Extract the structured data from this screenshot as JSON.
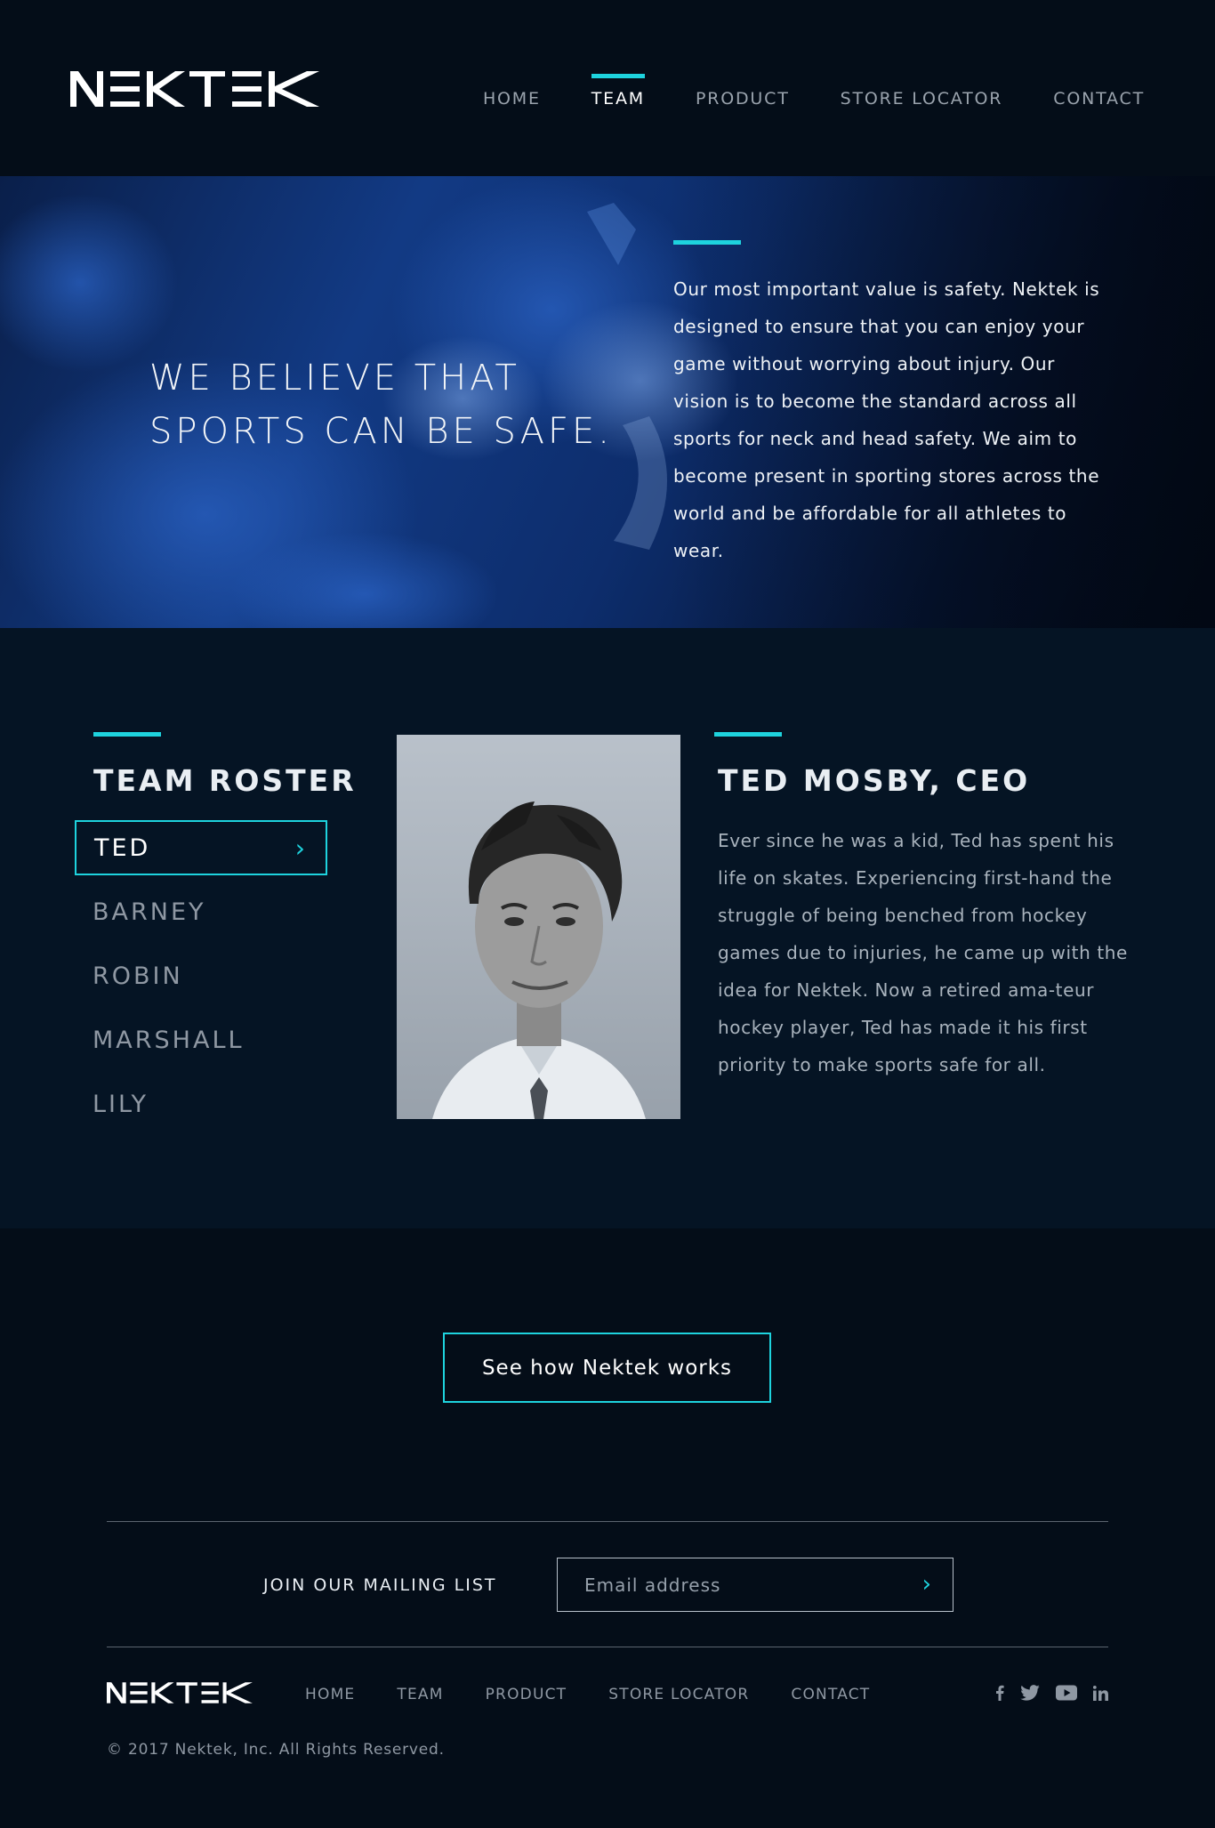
{
  "brand": {
    "name": "NEKTEK",
    "accent": "#1ed3de",
    "bg": "#040d18"
  },
  "nav": {
    "items": [
      "HOME",
      "TEAM",
      "PRODUCT",
      "STORE LOCATOR",
      "CONTACT"
    ],
    "active": "TEAM"
  },
  "hero": {
    "title_line1": "WE BELIEVE THAT",
    "title_line2": "SPORTS CAN BE SAFE.",
    "text": "Our most important value is safety. Nektek is designed to ensure that you can enjoy your game without worrying about injury. Our vision is to become the standard across all sports for neck and head safety. We aim to become present in sporting stores across the world and be affordable for all athletes to wear."
  },
  "team": {
    "title": "TEAM ROSTER",
    "members": [
      "TED",
      "BARNEY",
      "ROBIN",
      "MARSHALL",
      "LILY"
    ],
    "selected": "TED",
    "bio_name": "TED MOSBY, CEO",
    "bio_text": "Ever since he was a kid, Ted has spent his life on skates. Experiencing first-hand the struggle of being benched from hockey games due to injuries, he came up with the idea for Nektek. Now a retired ama-teur hockey player, Ted has made it his first priority to make sports safe for all."
  },
  "cta": {
    "label": "See how Nektek works"
  },
  "footer": {
    "mailing_label": "JOIN OUR MAILING LIST",
    "email_placeholder": "Email address",
    "nav": [
      "HOME",
      "TEAM",
      "PRODUCT",
      "STORE LOCATOR",
      "CONTACT"
    ],
    "social": [
      "facebook-icon",
      "twitter-icon",
      "youtube-icon",
      "linkedin-icon"
    ],
    "copyright": "© 2017 Nektek, Inc. All Rights Reserved."
  }
}
